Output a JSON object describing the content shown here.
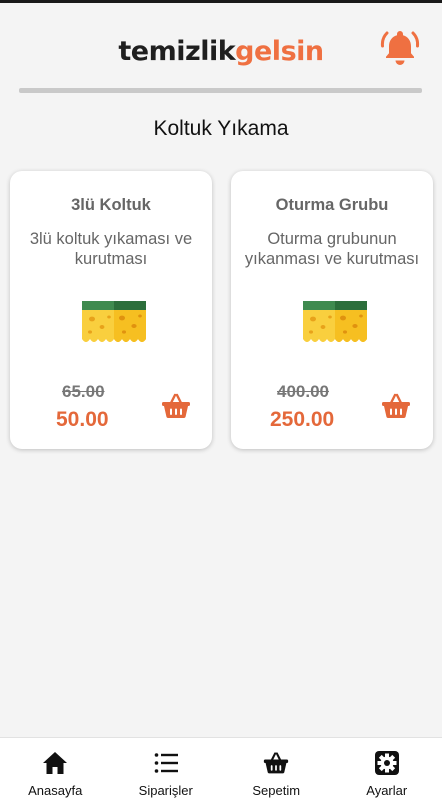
{
  "header": {
    "logo_part1": "temizlik",
    "logo_part2": "gelsin",
    "logo_color1": "#1f1f1f",
    "logo_color2": "#ef7041",
    "bell_icon": "bell-icon"
  },
  "page": {
    "title": "Koltuk Yıkama"
  },
  "products": [
    {
      "name": "3lü Koltuk",
      "description": "3lü koltuk yıkaması ve kurutması",
      "old_price": "65.00",
      "price": "50.00",
      "image_icon": "sponge-icon",
      "cart_icon": "basket-icon"
    },
    {
      "name": "Oturma Grubu",
      "description": "Oturma grubunun yıkanması ve kurutması",
      "old_price": "400.00",
      "price": "250.00",
      "image_icon": "sponge-icon",
      "cart_icon": "basket-icon"
    }
  ],
  "colors": {
    "accent": "#e4683a",
    "text_muted": "#666666",
    "background": "#f4f4f4"
  },
  "bottom_nav": [
    {
      "label": "Anasayfa",
      "icon": "home-icon"
    },
    {
      "label": "Siparişler",
      "icon": "list-icon"
    },
    {
      "label": "Sepetim",
      "icon": "basket-icon"
    },
    {
      "label": "Ayarlar",
      "icon": "gear-icon"
    }
  ]
}
